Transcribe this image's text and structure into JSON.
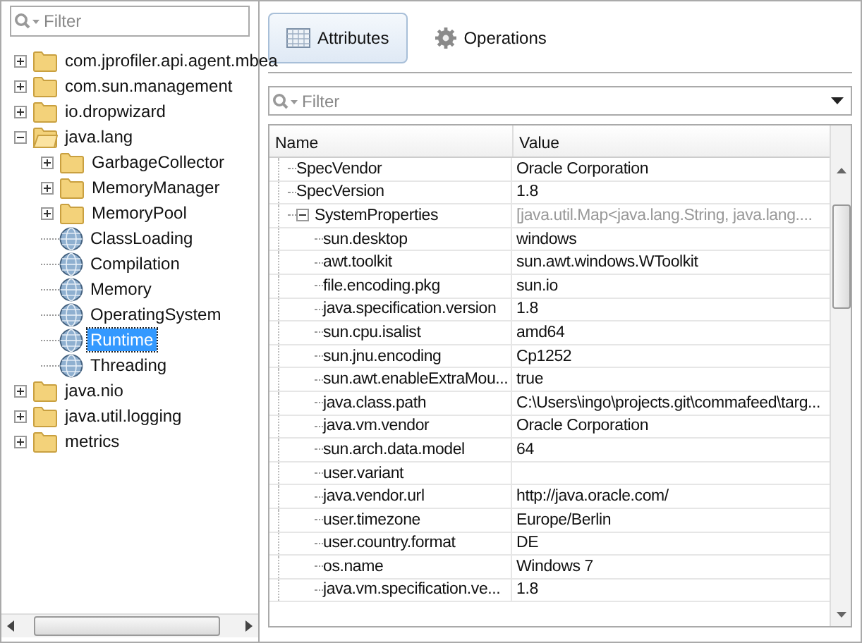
{
  "tree": {
    "filter": {
      "placeholder": "Filter"
    },
    "nodes": [
      {
        "label": "com.jprofiler.api.agent.mbea",
        "kind": "folder",
        "expanded": false,
        "selected": false
      },
      {
        "label": "com.sun.management",
        "kind": "folder",
        "expanded": false,
        "selected": false
      },
      {
        "label": "io.dropwizard",
        "kind": "folder",
        "expanded": false,
        "selected": false
      },
      {
        "label": "java.lang",
        "kind": "folder",
        "expanded": true,
        "selected": false,
        "children": [
          {
            "label": "GarbageCollector",
            "kind": "folder",
            "expanded": false,
            "selected": false
          },
          {
            "label": "MemoryManager",
            "kind": "folder",
            "expanded": false,
            "selected": false
          },
          {
            "label": "MemoryPool",
            "kind": "folder",
            "expanded": false,
            "selected": false
          },
          {
            "label": "ClassLoading",
            "kind": "bean",
            "selected": false
          },
          {
            "label": "Compilation",
            "kind": "bean",
            "selected": false
          },
          {
            "label": "Memory",
            "kind": "bean",
            "selected": false
          },
          {
            "label": "OperatingSystem",
            "kind": "bean",
            "selected": false
          },
          {
            "label": "Runtime",
            "kind": "bean",
            "selected": true
          },
          {
            "label": "Threading",
            "kind": "bean",
            "selected": false
          }
        ]
      },
      {
        "label": "java.nio",
        "kind": "folder",
        "expanded": false,
        "selected": false
      },
      {
        "label": "java.util.logging",
        "kind": "folder",
        "expanded": false,
        "selected": false
      },
      {
        "label": "metrics",
        "kind": "folder",
        "expanded": false,
        "selected": false
      }
    ]
  },
  "tabs": [
    {
      "label": "Attributes",
      "kind": "attributes",
      "selected": true
    },
    {
      "label": "Operations",
      "kind": "operations",
      "selected": false
    }
  ],
  "filter": {
    "placeholder": "Filter"
  },
  "table": {
    "columns": [
      "Name",
      "Value"
    ],
    "rows": [
      {
        "name": "SpecVendor",
        "value": "Oracle Corporation",
        "kind": "simple"
      },
      {
        "name": "SpecVersion",
        "value": "1.8",
        "kind": "simple"
      },
      {
        "name": "SystemProperties",
        "value": "[java.util.Map<java.lang.String, java.lang....",
        "kind": "map",
        "expanded": true,
        "children": [
          {
            "name": "sun.desktop",
            "value": "windows"
          },
          {
            "name": "awt.toolkit",
            "value": "sun.awt.windows.WToolkit"
          },
          {
            "name": "file.encoding.pkg",
            "value": "sun.io"
          },
          {
            "name": "java.specification.version",
            "value": "1.8"
          },
          {
            "name": "sun.cpu.isalist",
            "value": "amd64"
          },
          {
            "name": "sun.jnu.encoding",
            "value": "Cp1252"
          },
          {
            "name": "sun.awt.enableExtraMou...",
            "value": "true"
          },
          {
            "name": "java.class.path",
            "value": "C:\\Users\\ingo\\projects.git\\commafeed\\targ..."
          },
          {
            "name": "java.vm.vendor",
            "value": "Oracle Corporation"
          },
          {
            "name": "sun.arch.data.model",
            "value": "64"
          },
          {
            "name": "user.variant"
          },
          {
            "name": "java.vendor.url",
            "value": "http://java.oracle.com/"
          },
          {
            "name": "user.timezone",
            "value": "Europe/Berlin"
          },
          {
            "name": "user.country.format",
            "value": "DE"
          },
          {
            "name": "os.name",
            "value": "Windows 7"
          },
          {
            "name": "java.vm.specification.ve...",
            "value": "1.8"
          }
        ]
      }
    ]
  }
}
